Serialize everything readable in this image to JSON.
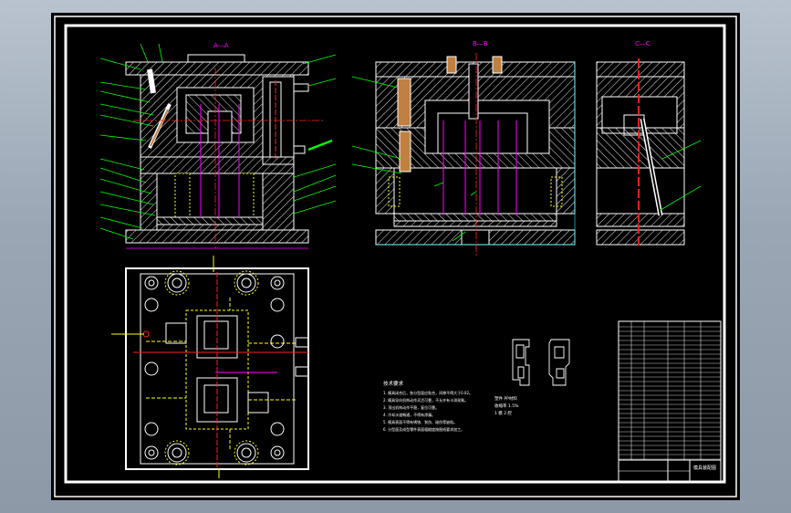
{
  "drawing": {
    "view_label_front": "A—A",
    "view_label_side": "B—B",
    "view_label_detail": "C—C",
    "title_block_name": "模具装配图",
    "tech_heading": "技术要求",
    "tech_requirements": [
      "1. 模具闭合后，各分型面应贴合，间隙不得大于0.02。",
      "2. 模具导向机构动作灵活可靠，不允许有卡滞现象。",
      "3. 顶出机构动作平稳，复位可靠。",
      "4. 冷却水道畅通，不得有渗漏。",
      "5. 模具表面不得有锈蚀、划伤、碰伤等缺陷。",
      "6. 分型面及成型零件表面粗糙度按图纸要求加工。"
    ],
    "part_notes": [
      "塑件  PP材料",
      "收缩率 1.5%",
      "1 模 2 腔"
    ]
  },
  "colors": {
    "background": "#000000",
    "line": "#ffffff",
    "hatch": "#ffffff",
    "centerline": "#ff2020",
    "leader": "#00ff00",
    "pin_magenta": "#ff00ff",
    "spring_yellow": "#ffff00",
    "dimension_cyan": "#00ffff",
    "highlight_brown": "#c08040"
  }
}
